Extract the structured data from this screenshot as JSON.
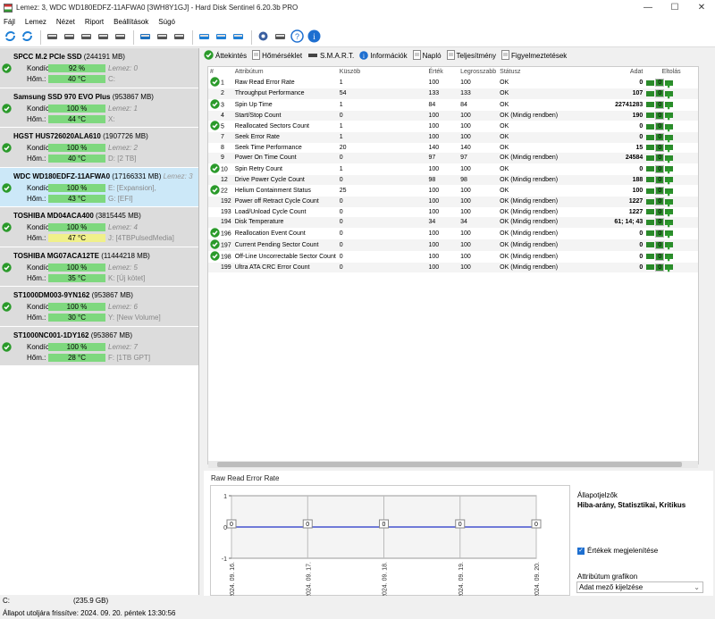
{
  "window": {
    "title": "Lemez: 3, WDC WD180EDFZ-11AFWA0 [3WH8Y1GJ]  -  Hard Disk Sentinel 6.20.3b PRO"
  },
  "menu": [
    "Fájl",
    "Lemez",
    "Nézet",
    "Riport",
    "Beállítások",
    "Súgó"
  ],
  "toolbar_icons": [
    "refresh-icon",
    "refresh-all-icon",
    "disk-list-icon",
    "disk-test-icon",
    "disk-test-2-icon",
    "disk-ok-icon",
    "disk-timer-icon",
    "network-icon",
    "disk-report-icon",
    "disk-save-icon",
    "clipboard-icon",
    "mail-icon",
    "mail-send-icon",
    "settings-icon",
    "sound-icon",
    "help-icon",
    "info-icon"
  ],
  "disks": [
    {
      "name": "SPCC M.2 PCIe SSD",
      "size": "(244191 MB)",
      "lemez": "",
      "health": "92 %",
      "temp": "40 °C",
      "part": "C:",
      "part_italic": false,
      "warm": false,
      "selected": false
    },
    {
      "name": "Samsung SSD 970 EVO Plus",
      "size": "(953867 MB)",
      "lemez": "",
      "health": "100 %",
      "temp": "44 °C",
      "part": "X:",
      "part_italic": false,
      "warm": false,
      "selected": false
    },
    {
      "name": "HGST HUS726020ALA610",
      "size": "(1907726 MB)",
      "lemez": "",
      "health": "100 %",
      "temp": "40 °C",
      "part": "D: [2 TB]",
      "part_italic": false,
      "warm": false,
      "selected": false
    },
    {
      "name": "WDC WD180EDFZ-11AFWA0",
      "size": "(17166331 MB)",
      "lemez": "Lemez: 3",
      "health": "100 %",
      "temp": "43 °C",
      "part": "E: [Expansion],",
      "part2": "G: [EFI]",
      "part_italic": false,
      "warm": false,
      "selected": true
    },
    {
      "name": "TOSHIBA MD04ACA400",
      "size": "(3815445 MB)",
      "lemez": "",
      "health": "100 %",
      "temp": "47 °C",
      "part": "J: [4TBPulsedMedia]",
      "part_italic": false,
      "warm": true,
      "selected": false
    },
    {
      "name": "TOSHIBA MG07ACA12TE",
      "size": "(11444218 MB)",
      "lemez": "",
      "health": "100 %",
      "temp": "35 °C",
      "part": "K: [Új kötet]",
      "part_italic": false,
      "warm": false,
      "selected": false
    },
    {
      "name": "ST1000DM003-9YN162",
      "size": "(953867 MB)",
      "lemez": "",
      "health": "100 %",
      "temp": "30 °C",
      "part": "Y: [New Volume]",
      "part_italic": false,
      "warm": false,
      "selected": false
    },
    {
      "name": "ST1000NC001-1DY162",
      "size": "(953867 MB)",
      "lemez": "",
      "health": "100 %",
      "temp": "28 °C",
      "part": "F: [1TB GPT]",
      "part_italic": false,
      "warm": false,
      "selected": false
    }
  ],
  "lemez_labels": [
    "Lemez: 0",
    "Lemez: 1",
    "Lemez: 2",
    "Lemez: 3",
    "Lemez: 4",
    "Lemez: 5",
    "Lemez: 6",
    "Lemez: 7"
  ],
  "disk_labels": {
    "kondicio": "Kondíció:",
    "hom": "Hőm.:"
  },
  "left_status": {
    "drive": "C:",
    "size": "(235.9 GB)"
  },
  "tabs": [
    {
      "label": "Áttekintés",
      "icon": "check-icon"
    },
    {
      "label": "Hőmérséklet",
      "icon": "document-icon"
    },
    {
      "label": "S.M.A.R.T.",
      "icon": "smart-icon"
    },
    {
      "label": "Információk",
      "icon": "info-icon"
    },
    {
      "label": "Napló",
      "icon": "document-icon"
    },
    {
      "label": "Teljesítmény",
      "icon": "chart-doc-icon"
    },
    {
      "label": "Figyelmeztetések",
      "icon": "warning-doc-icon"
    }
  ],
  "smart": {
    "headers": [
      "#",
      "Attribútum",
      "Küszöb",
      "Érték",
      "Legrosszabb",
      "Státusz",
      "Adat",
      "Eltolás"
    ],
    "rows": [
      {
        "id": "1",
        "attr": "Raw Read Error Rate",
        "thr": "1",
        "val": "100",
        "worst": "100",
        "status": "OK",
        "data": "0",
        "icon": true
      },
      {
        "id": "2",
        "attr": "Throughput Performance",
        "thr": "54",
        "val": "133",
        "worst": "133",
        "status": "OK",
        "data": "107",
        "icon": false
      },
      {
        "id": "3",
        "attr": "Spin Up Time",
        "thr": "1",
        "val": "84",
        "worst": "84",
        "status": "OK",
        "data": "22741283",
        "icon": true
      },
      {
        "id": "4",
        "attr": "Start/Stop Count",
        "thr": "0",
        "val": "100",
        "worst": "100",
        "status": "OK (Mindig rendben)",
        "data": "190",
        "icon": false
      },
      {
        "id": "5",
        "attr": "Reallocated Sectors Count",
        "thr": "1",
        "val": "100",
        "worst": "100",
        "status": "OK",
        "data": "0",
        "icon": true
      },
      {
        "id": "7",
        "attr": "Seek Error Rate",
        "thr": "1",
        "val": "100",
        "worst": "100",
        "status": "OK",
        "data": "0",
        "icon": false
      },
      {
        "id": "8",
        "attr": "Seek Time Performance",
        "thr": "20",
        "val": "140",
        "worst": "140",
        "status": "OK",
        "data": "15",
        "icon": false
      },
      {
        "id": "9",
        "attr": "Power On Time Count",
        "thr": "0",
        "val": "97",
        "worst": "97",
        "status": "OK (Mindig rendben)",
        "data": "24584",
        "icon": false
      },
      {
        "id": "10",
        "attr": "Spin Retry Count",
        "thr": "1",
        "val": "100",
        "worst": "100",
        "status": "OK",
        "data": "0",
        "icon": true
      },
      {
        "id": "12",
        "attr": "Drive Power Cycle Count",
        "thr": "0",
        "val": "98",
        "worst": "98",
        "status": "OK (Mindig rendben)",
        "data": "188",
        "icon": false
      },
      {
        "id": "22",
        "attr": "Helium Containment Status",
        "thr": "25",
        "val": "100",
        "worst": "100",
        "status": "OK",
        "data": "100",
        "icon": true
      },
      {
        "id": "192",
        "attr": "Power off Retract Cycle Count",
        "thr": "0",
        "val": "100",
        "worst": "100",
        "status": "OK (Mindig rendben)",
        "data": "1227",
        "icon": false
      },
      {
        "id": "193",
        "attr": "Load/Unload Cycle Count",
        "thr": "0",
        "val": "100",
        "worst": "100",
        "status": "OK (Mindig rendben)",
        "data": "1227",
        "icon": false
      },
      {
        "id": "194",
        "attr": "Disk Temperature",
        "thr": "0",
        "val": "34",
        "worst": "34",
        "status": "OK (Mindig rendben)",
        "data": "61; 14; 43",
        "icon": false
      },
      {
        "id": "196",
        "attr": "Reallocation Event Count",
        "thr": "0",
        "val": "100",
        "worst": "100",
        "status": "OK (Mindig rendben)",
        "data": "0",
        "icon": true
      },
      {
        "id": "197",
        "attr": "Current Pending Sector Count",
        "thr": "0",
        "val": "100",
        "worst": "100",
        "status": "OK (Mindig rendben)",
        "data": "0",
        "icon": true
      },
      {
        "id": "198",
        "attr": "Off-Line Uncorrectable Sector Count",
        "thr": "0",
        "val": "100",
        "worst": "100",
        "status": "OK (Mindig rendben)",
        "data": "0",
        "icon": true
      },
      {
        "id": "199",
        "attr": "Ultra ATA CRC Error Count",
        "thr": "0",
        "val": "100",
        "worst": "100",
        "status": "OK (Mindig rendben)",
        "data": "0",
        "icon": false
      }
    ],
    "offset_value": "0"
  },
  "chart_title": "Raw Read Error Rate",
  "chart_data": {
    "type": "line",
    "title": "Raw Read Error Rate",
    "x": [
      "2024. 09. 16.",
      "2024. 09. 17.",
      "2024. 09. 18.",
      "2024. 09. 19.",
      "2024. 09. 20."
    ],
    "values": [
      0,
      0,
      0,
      0,
      0
    ],
    "ylim": [
      -1,
      1
    ],
    "yticks": [
      "1",
      "0",
      "-1"
    ],
    "data_labels": [
      "0",
      "0",
      "0",
      "0",
      "0"
    ],
    "colors": {
      "line": "#2030c8",
      "grid": "#bbbbbb",
      "area": "#f4f4f4"
    }
  },
  "side": {
    "state_title": "Állapotjelzők",
    "state_values": "Hiba-arány, Statisztikai, Kritikus",
    "checkbox_label": "Értékek megjelenítése",
    "graph_title": "Attribútum grafikon",
    "graph_select": "Adat mező kijelzése"
  },
  "statusbar": "Állapot utoljára frissítve: 2024. 09. 20. péntek 13:30:56"
}
